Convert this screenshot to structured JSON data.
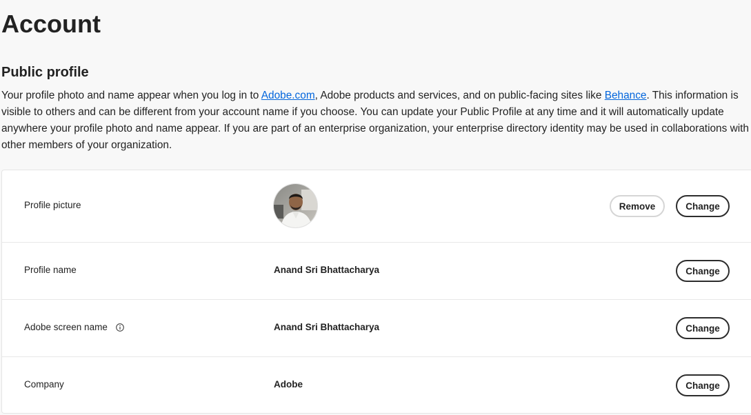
{
  "page": {
    "title": "Account"
  },
  "public_profile": {
    "title": "Public profile",
    "description_part1": "Your profile photo and name appear when you log in to ",
    "link1": "Adobe.com",
    "description_part2": ", Adobe products and services, and on public-facing sites like ",
    "link2": "Behance",
    "description_part3": ". This information is visible to others and can be different from your account name if you choose. You can update your Public Profile at any time and it will automatically update anywhere your profile photo and name appear. If you are part of an enterprise organization, your enterprise directory identity may be used in collaborations with other members of your organization."
  },
  "rows": {
    "profile_picture": {
      "label": "Profile picture",
      "remove_label": "Remove",
      "change_label": "Change"
    },
    "profile_name": {
      "label": "Profile name",
      "value": "Anand Sri Bhattacharya",
      "change_label": "Change"
    },
    "screen_name": {
      "label": "Adobe screen name",
      "icon": "info-icon",
      "value": "Anand Sri Bhattacharya",
      "change_label": "Change"
    },
    "company": {
      "label": "Company",
      "value": "Adobe",
      "change_label": "Change"
    }
  },
  "colors": {
    "background": "#f8f8f8",
    "card": "#ffffff",
    "link": "#0265dc",
    "text": "#222222",
    "button_border": "#2c2c2c",
    "secondary_border": "#d5d5d5"
  }
}
